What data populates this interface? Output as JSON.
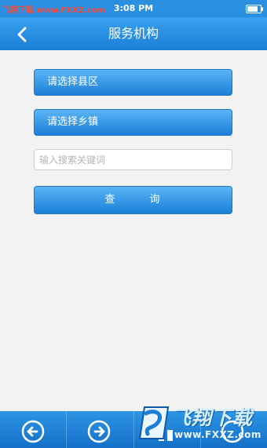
{
  "status_bar": {
    "carrier": "飞翔下载 www.FXXZ.com",
    "time": "3:08 PM"
  },
  "nav": {
    "title": "服务机构",
    "back_icon": "chevron-left-icon"
  },
  "form": {
    "county_select_label": "请选择县区",
    "town_select_label": "请选择乡镇",
    "search_placeholder": "输入搜索关键词",
    "search_value": "",
    "query_label": "查 询"
  },
  "toolbar": {
    "icons": [
      "arrow-left-circle-icon",
      "arrow-right-circle-icon",
      "home-icon",
      "refresh-icon"
    ]
  },
  "watermark": {
    "brand": "飞翔下载",
    "url": "www.FXXZ.com"
  },
  "colors": {
    "accent": "#1b7fd6",
    "button_top": "#5ab4f6",
    "background": "#f2f2f2",
    "carrier_text": "#ff4a3a"
  }
}
